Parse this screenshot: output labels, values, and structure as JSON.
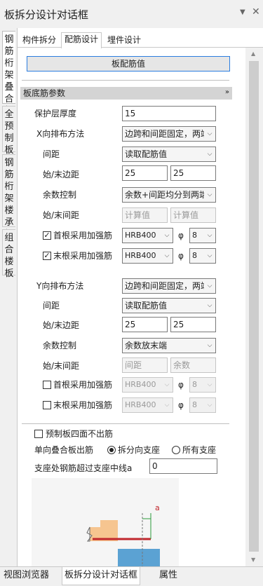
{
  "title": "板拆分设计对话框",
  "vertical_tabs": [
    "钢筋桁架叠合板",
    "全预制板",
    "钢筋桁架楼承板",
    "组合楼板"
  ],
  "tabs": [
    "构件拆分",
    "配筋设计",
    "埋件设计"
  ],
  "assign_button": "板配筋值",
  "section_title": "板底筋参数",
  "cover": {
    "label": "保护层厚度",
    "value": "15"
  },
  "x": {
    "layout_label": "X向排布方法",
    "layout_value": "边跨和间距固定，两端",
    "spacing_label": "间距",
    "spacing_value": "读取配筋值",
    "edge_label": "始/末边距",
    "edge_start": "25",
    "edge_end": "25",
    "remainder_label": "余数控制",
    "remainder_value": "余数+间距均分到两端",
    "gap_label": "始/末间距",
    "gap_start": "计算值",
    "gap_end": "计算值",
    "first_label": "首根采用加强筋",
    "first_grade": "HRB400",
    "first_dia": "8",
    "last_label": "末根采用加强筋",
    "last_grade": "HRB400",
    "last_dia": "8",
    "phi": "φ"
  },
  "y": {
    "layout_label": "Y向排布方法",
    "layout_value": "边跨和间距固定，两端",
    "spacing_label": "间距",
    "spacing_value": "读取配筋值",
    "edge_label": "始/末边距",
    "edge_start": "25",
    "edge_end": "25",
    "remainder_label": "余数控制",
    "remainder_value": "余数放末端",
    "gap_label": "始/末间距",
    "gap_start": "间距",
    "gap_end": "余数",
    "first_label": "首根采用加强筋",
    "first_grade": "HRB400",
    "first_dia": "8",
    "last_label": "末根采用加强筋",
    "last_grade": "HRB400",
    "last_dia": "8",
    "phi": "φ"
  },
  "no_out_label": "预制板四面不出筋",
  "one_way": {
    "label": "单向叠合板出筋",
    "opt1": "拆分向支座",
    "opt2": "所有支座"
  },
  "support": {
    "label": "支座处钢筋超过支座中线a",
    "value": "0"
  },
  "diagram": {
    "marker": "a"
  },
  "bottom_tabs": [
    "视图浏览器",
    "板拆分设计对话框",
    "属性"
  ]
}
